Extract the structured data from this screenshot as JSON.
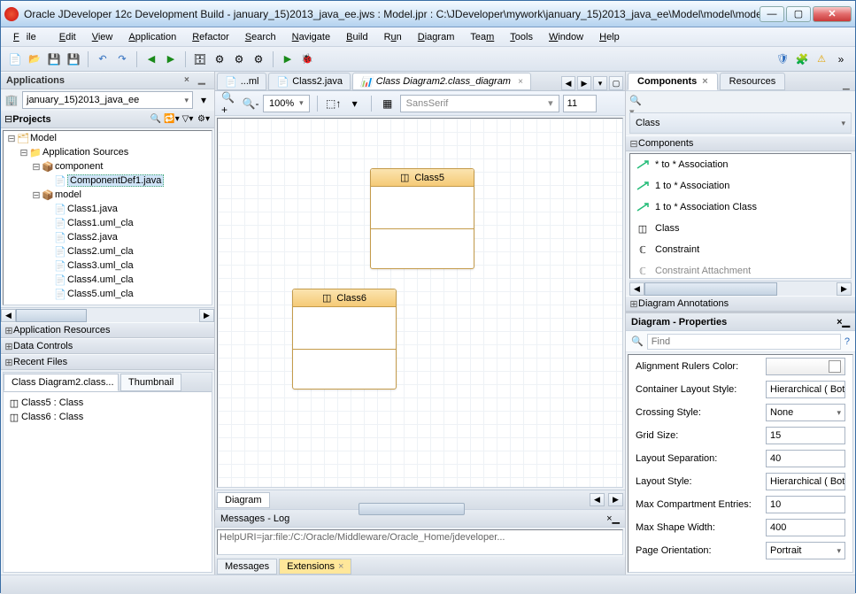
{
  "window": {
    "title": "Oracle JDeveloper 12c Development Build - january_15)2013_java_ee.jws : Model.jpr : C:\\JDeveloper\\mywork\\january_15)2013_java_ee\\Model\\model\\model\\..."
  },
  "menubar": [
    "File",
    "Edit",
    "View",
    "Application",
    "Refactor",
    "Search",
    "Navigate",
    "Build",
    "Run",
    "Diagram",
    "Team",
    "Tools",
    "Window",
    "Help"
  ],
  "left": {
    "applications_title": "Applications",
    "app_selected": "january_15)2013_java_ee",
    "projects_label": "Projects",
    "tree": {
      "model": "Model",
      "app_sources": "Application Sources",
      "component": "component",
      "component_def": "ComponentDef1.java",
      "model_pkg": "model",
      "files": [
        "Class1.java",
        "Class1.uml_cla",
        "Class2.java",
        "Class2.uml_cla",
        "Class3.uml_cla",
        "Class4.uml_cla",
        "Class5.uml_cla"
      ]
    },
    "accordion": {
      "app_resources": "Application Resources",
      "data_controls": "Data Controls",
      "recent_files": "Recent Files"
    },
    "lower": {
      "tab_overview": "Class Diagram2.class...",
      "tab_thumb": "Thumbnail",
      "items": [
        "Class5 : Class",
        "Class6 : Class"
      ]
    }
  },
  "editor": {
    "tabs": {
      "xml": "...ml",
      "class2": "Class2.java",
      "diagram": "Class Diagram2.class_diagram"
    },
    "zoom": "100%",
    "font": "SansSerif",
    "font_size": "11",
    "classes": {
      "c5": "Class5",
      "c6": "Class6"
    },
    "footer_tab": "Diagram"
  },
  "messages": {
    "title": "Messages - Log",
    "line": "HelpURI=jar:file:/C:/Oracle/Middleware/Oracle_Home/jdeveloper...",
    "tab_messages": "Messages",
    "tab_extensions": "Extensions"
  },
  "right": {
    "tab_components": "Components",
    "tab_resources": "Resources",
    "category": "Class",
    "section_components": "Components",
    "items": [
      "* to * Association",
      "1 to * Association",
      "1 to * Association Class",
      "Class",
      "Constraint",
      "Constraint Attachment"
    ],
    "section_annotations": "Diagram Annotations"
  },
  "props": {
    "title": "Diagram - Properties",
    "find_placeholder": "Find",
    "rows": [
      {
        "k": "Alignment Rulers Color:",
        "v": "",
        "type": "color"
      },
      {
        "k": "Container Layout Style:",
        "v": "Hierarchical ( Bot",
        "type": "dd"
      },
      {
        "k": "Crossing Style:",
        "v": "None",
        "type": "dd"
      },
      {
        "k": "Grid Size:",
        "v": "15",
        "type": "text"
      },
      {
        "k": "Layout Separation:",
        "v": "40",
        "type": "text"
      },
      {
        "k": "Layout Style:",
        "v": "Hierarchical ( Bot",
        "type": "dd"
      },
      {
        "k": "Max Compartment Entries:",
        "v": "10",
        "type": "text"
      },
      {
        "k": "Max Shape Width:",
        "v": "400",
        "type": "text"
      },
      {
        "k": "Page Orientation:",
        "v": "Portrait",
        "type": "dd"
      }
    ]
  }
}
